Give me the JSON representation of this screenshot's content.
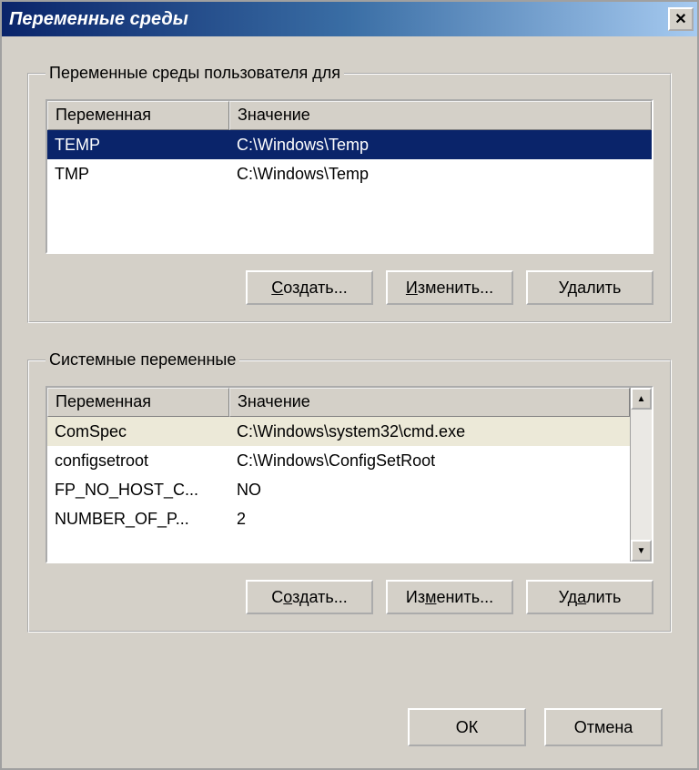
{
  "window": {
    "title": "Переменные среды",
    "close": "✕"
  },
  "user_group": {
    "legend": "Переменные среды пользователя для",
    "columns": {
      "var": "Переменная",
      "val": "Значение"
    },
    "rows": [
      {
        "var": "TEMP",
        "val": "C:\\Windows\\Temp",
        "selected": true
      },
      {
        "var": "TMP",
        "val": "C:\\Windows\\Temp",
        "selected": false
      }
    ],
    "buttons": {
      "create": "Создать...",
      "edit": "Изменить...",
      "delete": "Удалить"
    }
  },
  "system_group": {
    "legend": "Системные переменные",
    "columns": {
      "var": "Переменная",
      "val": "Значение"
    },
    "rows": [
      {
        "var": "ComSpec",
        "val": "C:\\Windows\\system32\\cmd.exe"
      },
      {
        "var": "configsetroot",
        "val": "C:\\Windows\\ConfigSetRoot"
      },
      {
        "var": "FP_NO_HOST_C...",
        "val": "NO"
      },
      {
        "var": "NUMBER_OF_P...",
        "val": "2"
      }
    ],
    "buttons": {
      "create": "Создать...",
      "edit": "Изменить...",
      "delete": "Удалить"
    }
  },
  "dialog_buttons": {
    "ok": "ОК",
    "cancel": "Отмена"
  },
  "scroll": {
    "up": "▲",
    "down": "▼"
  }
}
